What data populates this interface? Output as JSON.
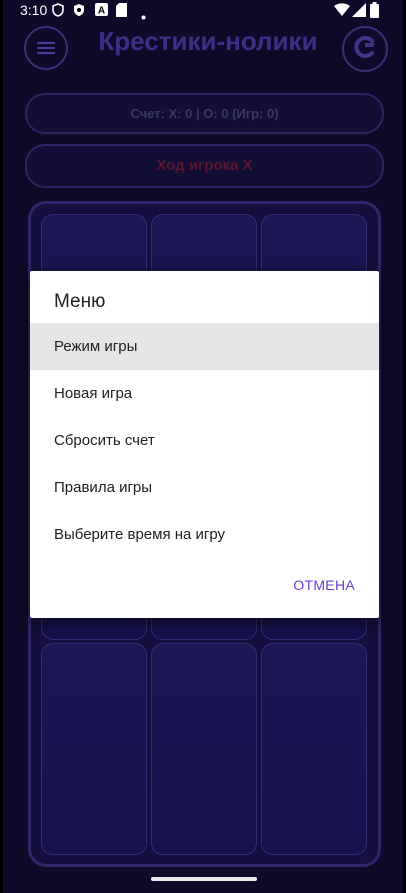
{
  "status_bar": {
    "time": "3:10"
  },
  "header": {
    "title": "Крестики-нолики",
    "menu_icon": "hamburger-icon",
    "reset_icon": "refresh-icon"
  },
  "score": {
    "text": "Счет: X: 0 | O: 0 (Игр: 0)"
  },
  "turn": {
    "text": "Ход игрока X"
  },
  "board": {
    "rows": 3,
    "cols": 3
  },
  "dialog": {
    "title": "Меню",
    "items": [
      {
        "label": "Режим игры",
        "selected": true
      },
      {
        "label": "Новая игра",
        "selected": false
      },
      {
        "label": "Сбросить счет",
        "selected": false
      },
      {
        "label": "Правила игры",
        "selected": false
      },
      {
        "label": "Выберите время на игру",
        "selected": false
      }
    ],
    "cancel_label": "ОТМЕНА"
  },
  "colors": {
    "background": "#0e0b2a",
    "accent": "#6a3fd6",
    "title": "#3d2f86",
    "turn_text": "#5a1430"
  }
}
